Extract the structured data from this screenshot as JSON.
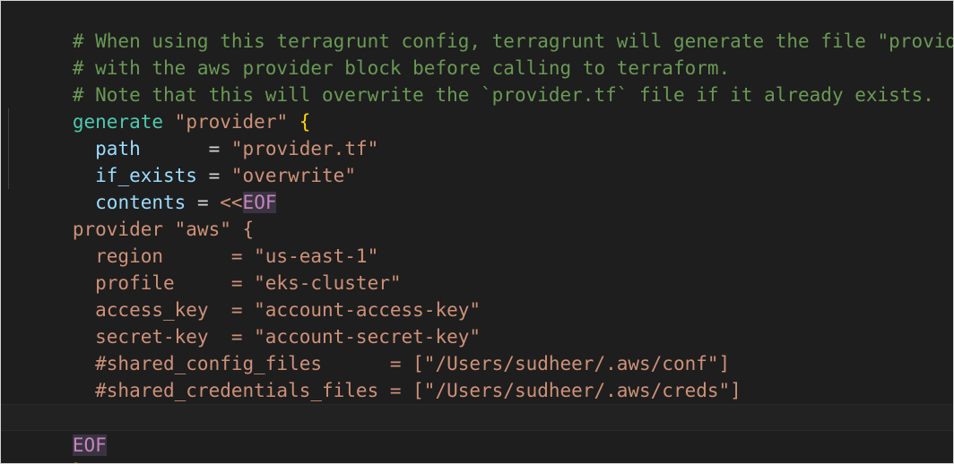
{
  "colors": {
    "background": "#1e1e1e",
    "comment": "#6a9955",
    "keyword": "#4ec9b0",
    "string": "#ce9178",
    "property": "#9cdcfe",
    "brace": "#ffd700",
    "heredoc": "#c586c0"
  },
  "code": {
    "line1": "# When using this terragrunt config, terragrunt will generate the file \"provider.tf\"",
    "line2": "# with the aws provider block before calling to terraform.",
    "line3": "# Note that this will overwrite the `provider.tf` file if it already exists.",
    "line4": {
      "keyword": "generate",
      "name": "\"provider\"",
      "brace": "{"
    },
    "line5": {
      "key": "path",
      "eq": "      = ",
      "value": "\"provider.tf\""
    },
    "line6": {
      "key": "if_exists",
      "eq": " = ",
      "value": "\"overwrite\""
    },
    "line7": {
      "key": "contents",
      "eq": " = ",
      "marker": "<<",
      "heredoc": "EOF"
    },
    "line8": "provider \"aws\" {",
    "line9": "  region      = \"us-east-1\"",
    "line10": "  profile     = \"eks-cluster\"",
    "line11": "  access_key  = \"account-access-key\"",
    "line12": "  secret-key  = \"account-secret-key\"",
    "line13": "  #shared_config_files      = [\"/Users/sudheer/.aws/conf\"]",
    "line14": "  #shared_credentials_files = [\"/Users/sudheer/.aws/creds\"]",
    "line15": "}",
    "line16": "EOF",
    "line17": "}"
  }
}
